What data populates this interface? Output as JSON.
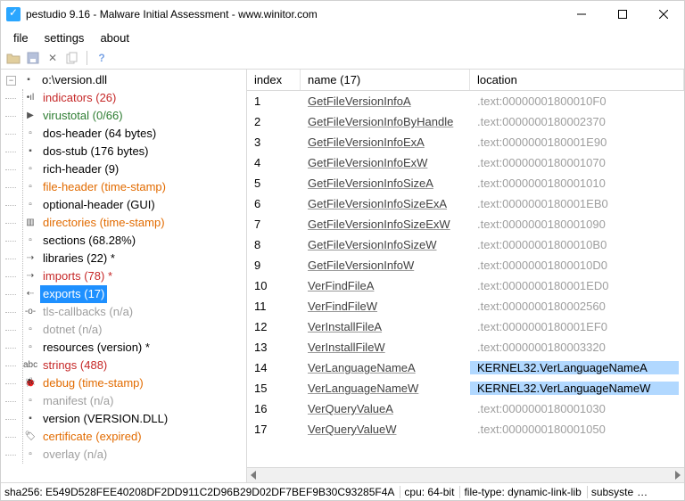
{
  "window": {
    "title": "pestudio 9.16 - Malware Initial Assessment - www.winitor.com"
  },
  "menu": {
    "file": "file",
    "settings": "settings",
    "about": "about"
  },
  "toolbar": {
    "open": "open-icon",
    "save": "save-icon",
    "delete": "delete-icon",
    "copy": "copy-icon",
    "help": "?"
  },
  "tree": {
    "root": {
      "expander": "−",
      "label": "o:\\version.dll"
    },
    "items": [
      {
        "label": "indicators (26)",
        "color": "cRed",
        "icon": "•ıl"
      },
      {
        "label": "virustotal (0/66)",
        "color": "cGreen",
        "icon": "▶"
      },
      {
        "label": "dos-header (64 bytes)",
        "color": "cBlack",
        "icon": "▫"
      },
      {
        "label": "dos-stub (176 bytes)",
        "color": "cBlack",
        "icon": "▪"
      },
      {
        "label": "rich-header (9)",
        "color": "cBlack",
        "icon": "▫"
      },
      {
        "label": "file-header (time-stamp)",
        "color": "cOrange",
        "icon": "▫"
      },
      {
        "label": "optional-header (GUI)",
        "color": "cBlack",
        "icon": "▫"
      },
      {
        "label": "directories (time-stamp)",
        "color": "cOrange",
        "icon": "▥"
      },
      {
        "label": "sections (68.28%)",
        "color": "cBlack",
        "icon": "▫"
      },
      {
        "label": "libraries (22) *",
        "color": "cBlack",
        "icon": "⇢"
      },
      {
        "label": "imports (78) *",
        "color": "cRed",
        "icon": "⇢"
      },
      {
        "label": "exports (17)",
        "color": "cBlack",
        "icon": "⇠",
        "selected": true
      },
      {
        "label": "tls-callbacks (n/a)",
        "color": "cGray",
        "icon": "-o-"
      },
      {
        "label": "dotnet (n/a)",
        "color": "cGray",
        "icon": "▫"
      },
      {
        "label": "resources (version) *",
        "color": "cBlack",
        "icon": "▫"
      },
      {
        "label": "strings (488)",
        "color": "cRed",
        "icon": "abc"
      },
      {
        "label": "debug (time-stamp)",
        "color": "cOrange",
        "icon": "🐞"
      },
      {
        "label": "manifest (n/a)",
        "color": "cGray",
        "icon": "▫"
      },
      {
        "label": "version (VERSION.DLL)",
        "color": "cBlack",
        "icon": "▪"
      },
      {
        "label": "certificate (expired)",
        "color": "cOrange",
        "icon": "🏷"
      },
      {
        "label": "overlay (n/a)",
        "color": "cGray",
        "icon": "▫"
      }
    ]
  },
  "table": {
    "columns": {
      "index": "index",
      "name": "name (17)",
      "location": "location"
    },
    "rows": [
      {
        "index": "1",
        "name": "GetFileVersionInfoA",
        "location": ".text:00000001800010F0",
        "hl": false
      },
      {
        "index": "2",
        "name": "GetFileVersionInfoByHandle",
        "location": ".text:0000000180002370",
        "hl": false
      },
      {
        "index": "3",
        "name": "GetFileVersionInfoExA",
        "location": ".text:0000000180001E90",
        "hl": false
      },
      {
        "index": "4",
        "name": "GetFileVersionInfoExW",
        "location": ".text:0000000180001070",
        "hl": false
      },
      {
        "index": "5",
        "name": "GetFileVersionInfoSizeA",
        "location": ".text:0000000180001010",
        "hl": false
      },
      {
        "index": "6",
        "name": "GetFileVersionInfoSizeExA",
        "location": ".text:0000000180001EB0",
        "hl": false
      },
      {
        "index": "7",
        "name": "GetFileVersionInfoSizeExW",
        "location": ".text:0000000180001090",
        "hl": false
      },
      {
        "index": "8",
        "name": "GetFileVersionInfoSizeW",
        "location": ".text:00000001800010B0",
        "hl": false
      },
      {
        "index": "9",
        "name": "GetFileVersionInfoW",
        "location": ".text:00000001800010D0",
        "hl": false
      },
      {
        "index": "10",
        "name": "VerFindFileA",
        "location": ".text:0000000180001ED0",
        "hl": false
      },
      {
        "index": "11",
        "name": "VerFindFileW",
        "location": ".text:0000000180002560",
        "hl": false
      },
      {
        "index": "12",
        "name": "VerInstallFileA",
        "location": ".text:0000000180001EF0",
        "hl": false
      },
      {
        "index": "13",
        "name": "VerInstallFileW",
        "location": ".text:0000000180003320",
        "hl": false
      },
      {
        "index": "14",
        "name": "VerLanguageNameA",
        "location": "KERNEL32.VerLanguageNameA",
        "hl": true
      },
      {
        "index": "15",
        "name": "VerLanguageNameW",
        "location": "KERNEL32.VerLanguageNameW",
        "hl": true
      },
      {
        "index": "16",
        "name": "VerQueryValueA",
        "location": ".text:0000000180001030",
        "hl": false
      },
      {
        "index": "17",
        "name": "VerQueryValueW",
        "location": ".text:0000000180001050",
        "hl": false
      }
    ]
  },
  "status": {
    "sha": "sha256: E549D528FEE40208DF2DD911C2D96B29D02DF7BEF9B30C93285F4A",
    "cpu": "cpu: 64-bit",
    "filetype": "file-type: dynamic-link-lib",
    "subsys": "subsyste"
  }
}
